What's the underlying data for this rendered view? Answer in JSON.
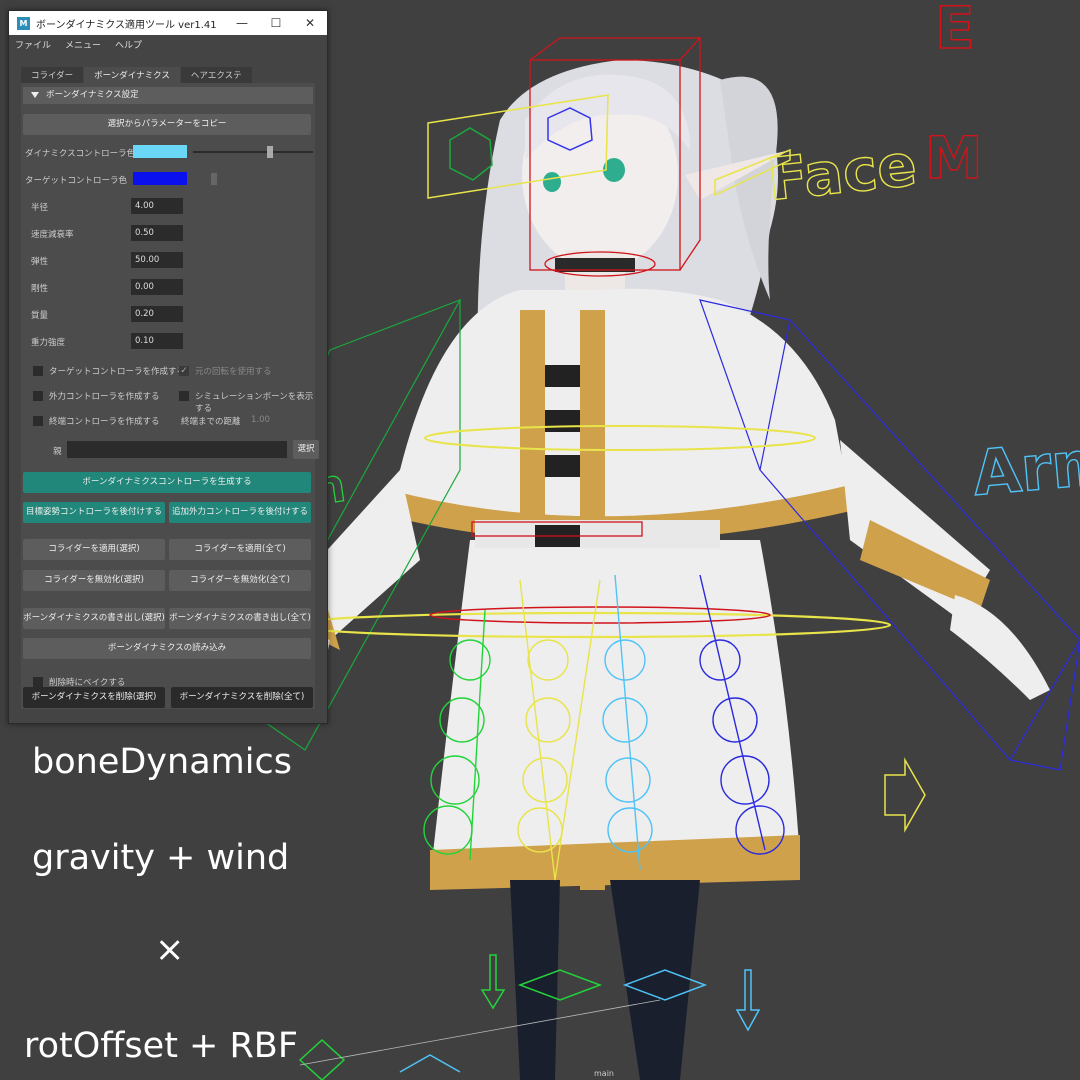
{
  "window": {
    "app_icon": "M",
    "title": "ボーンダイナミクス適用ツール ver1.41",
    "controls": {
      "minimize": "—",
      "maximize": "☐",
      "close": "✕"
    }
  },
  "menu": [
    "ファイル",
    "メニュー",
    "ヘルプ"
  ],
  "tabs": [
    "コライダー",
    "ボーンダイナミクス",
    "ヘアエクステ"
  ],
  "active_tab": 1,
  "section": {
    "title": "ボーンダイナミクス設定"
  },
  "copy_params_button": "選択からパラメーターをコピー",
  "colors": {
    "dynamics_label": "ダイナミクスコントローラ色",
    "dynamics_color": "#6ad7f7",
    "target_label": "ターゲットコントローラ色",
    "target_color": "#0a10ee"
  },
  "params": [
    {
      "label": "半径",
      "value": "4.00"
    },
    {
      "label": "速度減衰率",
      "value": "0.50"
    },
    {
      "label": "弾性",
      "value": "50.00"
    },
    {
      "label": "剛性",
      "value": "0.00"
    },
    {
      "label": "質量",
      "value": "0.20"
    },
    {
      "label": "重力強度",
      "value": "0.10"
    }
  ],
  "options": {
    "create_target": "ターゲットコントローラを作成する",
    "use_original_rotation": "元の回転を使用する",
    "create_external": "外力コントローラを作成する",
    "show_sim_bones": "シミュレーションボーンを表示する",
    "create_end": "終端コントローラを作成する",
    "end_distance_label": "終端までの距離",
    "end_distance_value": "1.00"
  },
  "parent": {
    "label": "親",
    "select_button": "選択"
  },
  "buttons": {
    "generate": "ボーンダイナミクスコントローラを生成する",
    "attach_target": "目標姿勢コントローラを後付けする",
    "attach_external": "追加外力コントローラを後付けする",
    "apply_collider_sel": "コライダーを適用(選択)",
    "apply_collider_all": "コライダーを適用(全て)",
    "disable_collider_sel": "コライダーを無効化(選択)",
    "disable_collider_all": "コライダーを無効化(全て)",
    "export_sel": "ボーンダイナミクスの書き出し(選択)",
    "export_all": "ボーンダイナミクスの書き出し(全て)",
    "import": "ボーンダイナミクスの読み込み",
    "bake_on_delete": "削除時にベイクする",
    "delete_sel": "ボーンダイナミクスを削除(選択)",
    "delete_all": "ボーンダイナミクスを削除(全て)"
  },
  "viewport_labels": {
    "face": "Face",
    "m": "M",
    "e": "E",
    "arm_right": "Arm",
    "arm_left": "Arm",
    "camera": "main"
  },
  "overlay_text": [
    "boneDynamics",
    "gravity + wind",
    "×",
    "rotOffset + RBF"
  ]
}
